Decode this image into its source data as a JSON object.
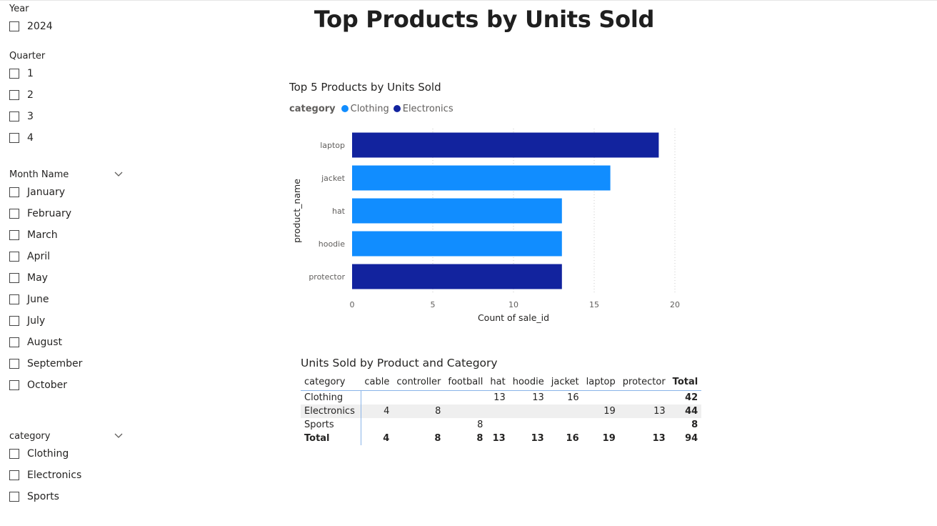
{
  "page": {
    "title": "Top Products by Units Sold"
  },
  "slicers": {
    "year": {
      "title": "Year",
      "options": [
        "2024"
      ]
    },
    "quarter": {
      "title": "Quarter",
      "options": [
        "1",
        "2",
        "3",
        "4"
      ]
    },
    "month": {
      "title": "Month Name",
      "options": [
        "January",
        "February",
        "March",
        "April",
        "May",
        "June",
        "July",
        "August",
        "September",
        "October"
      ]
    },
    "category": {
      "title": "category",
      "options": [
        "Clothing",
        "Electronics",
        "Sports"
      ]
    }
  },
  "chart_data": [
    {
      "type": "bar",
      "orientation": "horizontal",
      "title": "Top 5 Products by Units Sold",
      "legend_title": "category",
      "legend_position": "top-left",
      "legend": [
        {
          "name": "Clothing",
          "color": "#118dff"
        },
        {
          "name": "Electronics",
          "color": "#12239e"
        }
      ],
      "categories": [
        "laptop",
        "jacket",
        "hat",
        "hoodie",
        "protector"
      ],
      "values": [
        19,
        16,
        13,
        13,
        13
      ],
      "bar_category": [
        "Electronics",
        "Clothing",
        "Clothing",
        "Clothing",
        "Electronics"
      ],
      "xlabel": "Count of sale_id",
      "ylabel": "product_name",
      "xlim": [
        0,
        20
      ],
      "xticks": [
        "0",
        "5",
        "10",
        "15",
        "20"
      ],
      "grid": true
    },
    {
      "type": "table",
      "title": "Units Sold by Product and Category",
      "columns": [
        "category",
        "cable",
        "controller",
        "football",
        "hat",
        "hoodie",
        "jacket",
        "laptop",
        "protector",
        "Total"
      ],
      "rows": [
        [
          "Clothing",
          "",
          "",
          "",
          "13",
          "13",
          "16",
          "",
          "",
          "42"
        ],
        [
          "Electronics",
          "4",
          "8",
          "",
          "",
          "",
          "",
          "19",
          "13",
          "44"
        ],
        [
          "Sports",
          "",
          "",
          "8",
          "",
          "",
          "",
          "",
          "",
          "8"
        ],
        [
          "Total",
          "4",
          "8",
          "8",
          "13",
          "13",
          "16",
          "19",
          "13",
          "94"
        ]
      ]
    }
  ]
}
